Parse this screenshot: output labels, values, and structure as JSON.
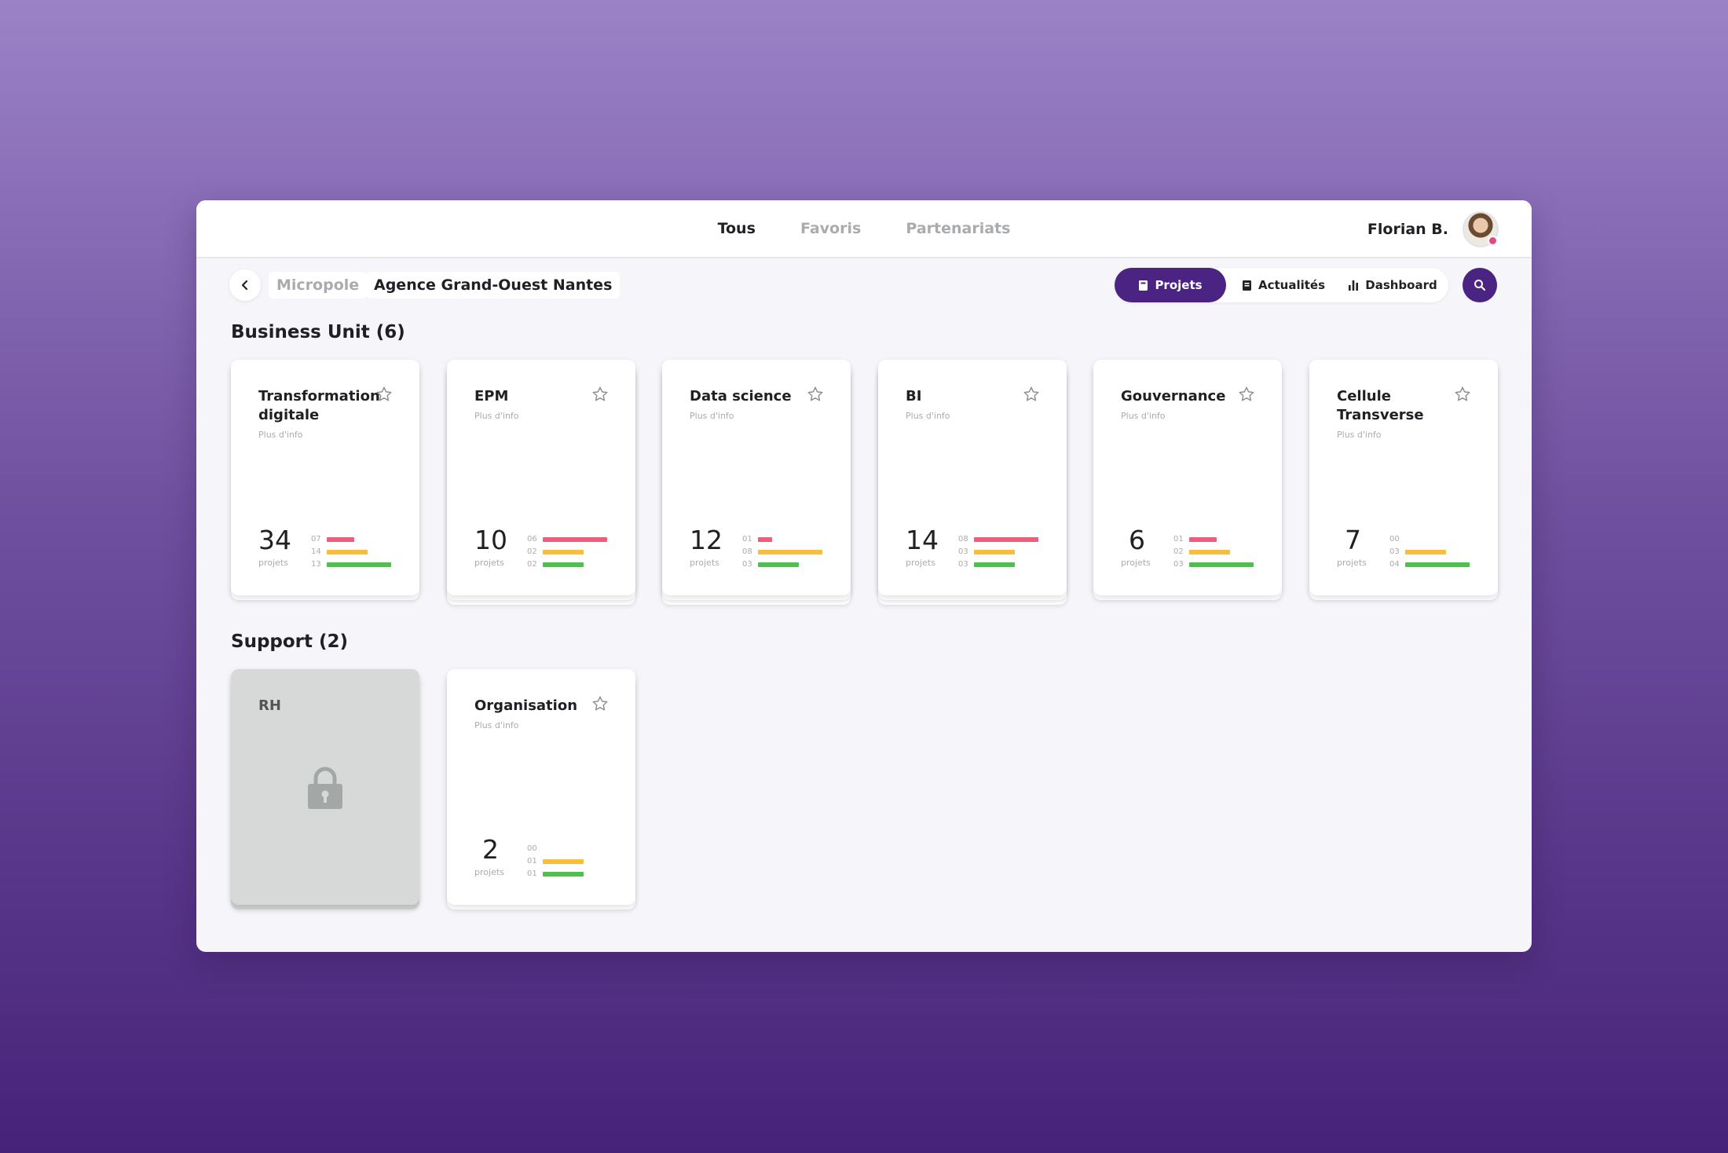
{
  "nav": {
    "tabs": [
      {
        "label": "Tous",
        "active": true
      },
      {
        "label": "Favoris",
        "active": false
      },
      {
        "label": "Partenariats",
        "active": false
      }
    ],
    "user_name": "Florian B."
  },
  "breadcrumb": {
    "parent": "Micropole",
    "current": "Agence Grand-Ouest Nantes"
  },
  "view_tabs": [
    {
      "label": "Projets",
      "icon": "book-icon",
      "active": true
    },
    {
      "label": "Actualités",
      "icon": "news-icon",
      "active": false
    },
    {
      "label": "Dashboard",
      "icon": "bar-chart-icon",
      "active": false
    }
  ],
  "colors": {
    "accent": "#4b2483",
    "red": "#ec5f7b",
    "yellow": "#f6be3a",
    "green": "#4fbf4e",
    "locked": "#d6d9d8"
  },
  "sections": {
    "business": {
      "title": "Business Unit (6)",
      "cards": [
        {
          "name": "Transformation digitale",
          "link": "Plus d'info",
          "count": "34",
          "count_label": "projets",
          "stats": [
            {
              "num": "07",
              "value": 7
            },
            {
              "num": "14",
              "value": 14
            },
            {
              "num": "13",
              "value": 13
            }
          ]
        },
        {
          "name": "EPM",
          "link": "Plus d'info",
          "count": "10",
          "count_label": "projets",
          "stats": [
            {
              "num": "06",
              "value": 6
            },
            {
              "num": "02",
              "value": 2
            },
            {
              "num": "02",
              "value": 2
            }
          ]
        },
        {
          "name": "Data science",
          "link": "Plus d'info",
          "count": "12",
          "count_label": "projets",
          "stats": [
            {
              "num": "01",
              "value": 1
            },
            {
              "num": "08",
              "value": 8
            },
            {
              "num": "03",
              "value": 3
            }
          ]
        },
        {
          "name": "BI",
          "link": "Plus d'info",
          "count": "14",
          "count_label": "projets",
          "stats": [
            {
              "num": "08",
              "value": 8
            },
            {
              "num": "03",
              "value": 3
            },
            {
              "num": "03",
              "value": 3
            }
          ]
        },
        {
          "name": "Gouvernance",
          "link": "Plus d'info",
          "count": "6",
          "count_label": "projets",
          "stats": [
            {
              "num": "01",
              "value": 1
            },
            {
              "num": "02",
              "value": 2
            },
            {
              "num": "03",
              "value": 3
            }
          ]
        },
        {
          "name": "Cellule Transverse",
          "link": "Plus d'info",
          "count": "7",
          "count_label": "projets",
          "stats": [
            {
              "num": "00",
              "value": 0
            },
            {
              "num": "03",
              "value": 3
            },
            {
              "num": "04",
              "value": 4
            }
          ]
        }
      ]
    },
    "support": {
      "title": "Support (2)",
      "cards": [
        {
          "name": "RH",
          "locked": true
        },
        {
          "name": "Organisation",
          "link": "Plus d'info",
          "count": "2",
          "count_label": "projets",
          "stats": [
            {
              "num": "00",
              "value": 0
            },
            {
              "num": "01",
              "value": 1
            },
            {
              "num": "01",
              "value": 1
            }
          ]
        }
      ]
    }
  }
}
